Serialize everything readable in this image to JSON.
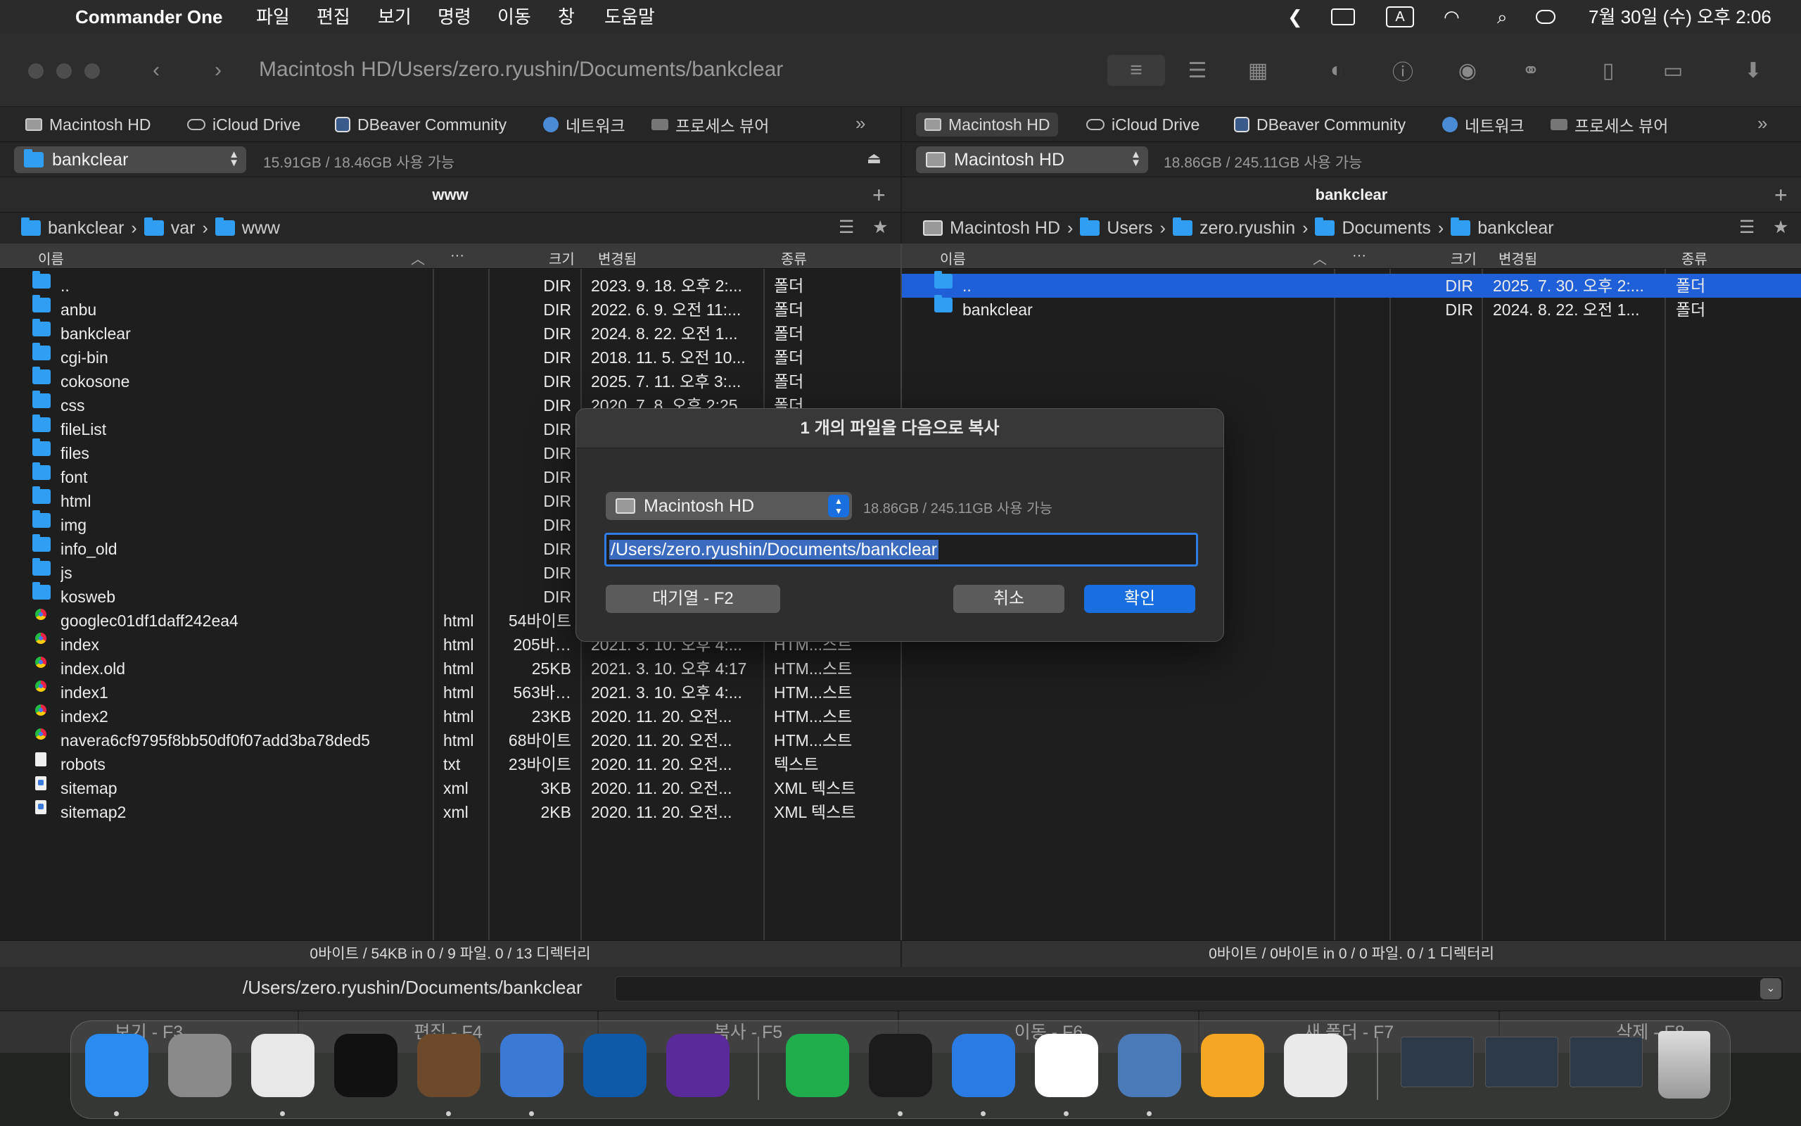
{
  "menubar": {
    "app_name": "Commander One",
    "menus": [
      "파일",
      "편집",
      "보기",
      "명령",
      "이동",
      "창",
      "도움말"
    ],
    "datetime": "7월 30일 (수) 오후 2:06",
    "input_indicator": "A"
  },
  "window": {
    "title_path": "Macintosh HD/Users/zero.ryushin/Documents/bankclear"
  },
  "left": {
    "drives": [
      "Macintosh HD",
      "iCloud Drive",
      "DBeaver Community",
      "네트워크",
      "프로세스 뷰어"
    ],
    "volume": "bankclear",
    "free_space": "15.91GB / 18.46GB 사용 가능",
    "tab_title": "www",
    "breadcrumb": [
      "bankclear",
      "var",
      "www"
    ],
    "columns": {
      "name": "이름",
      "ext": "···",
      "size": "크기",
      "modified": "변경됨",
      "kind": "종류"
    },
    "rows": [
      {
        "name": "..",
        "ext": "",
        "size": "DIR",
        "date": "2023. 9. 18. 오후 2:...",
        "kind": "폴더",
        "icon": "folder"
      },
      {
        "name": "anbu",
        "ext": "",
        "size": "DIR",
        "date": "2022. 6. 9. 오전 11:...",
        "kind": "폴더",
        "icon": "folder"
      },
      {
        "name": "bankclear",
        "ext": "",
        "size": "DIR",
        "date": "2024. 8. 22. 오전 1...",
        "kind": "폴더",
        "icon": "folder"
      },
      {
        "name": "cgi-bin",
        "ext": "",
        "size": "DIR",
        "date": "2018. 11. 5. 오전 10...",
        "kind": "폴더",
        "icon": "folder"
      },
      {
        "name": "cokosone",
        "ext": "",
        "size": "DIR",
        "date": "2025. 7. 11. 오후 3:...",
        "kind": "폴더",
        "icon": "folder"
      },
      {
        "name": "css",
        "ext": "",
        "size": "DIR",
        "date": "2020. 7. 8. 오후 2:25",
        "kind": "폴더",
        "icon": "folder"
      },
      {
        "name": "fileList",
        "ext": "",
        "size": "DIR",
        "date": "",
        "kind": "",
        "icon": "folder"
      },
      {
        "name": "files",
        "ext": "",
        "size": "DIR",
        "date": "",
        "kind": "",
        "icon": "folder"
      },
      {
        "name": "font",
        "ext": "",
        "size": "DIR",
        "date": "",
        "kind": "",
        "icon": "folder"
      },
      {
        "name": "html",
        "ext": "",
        "size": "DIR",
        "date": "",
        "kind": "",
        "icon": "folder"
      },
      {
        "name": "img",
        "ext": "",
        "size": "DIR",
        "date": "",
        "kind": "",
        "icon": "folder"
      },
      {
        "name": "info_old",
        "ext": "",
        "size": "DIR",
        "date": "",
        "kind": "",
        "icon": "folder"
      },
      {
        "name": "js",
        "ext": "",
        "size": "DIR",
        "date": "",
        "kind": "",
        "icon": "folder"
      },
      {
        "name": "kosweb",
        "ext": "",
        "size": "DIR",
        "date": "",
        "kind": "",
        "icon": "folder"
      },
      {
        "name": "googlec01df1daff242ea4",
        "ext": "html",
        "size": "54바이트",
        "date": "",
        "kind": "",
        "icon": "chrome"
      },
      {
        "name": "index",
        "ext": "html",
        "size": "205바…",
        "date": "2021. 3. 10. 오후 4:...",
        "kind": "HTM...스트",
        "icon": "chrome"
      },
      {
        "name": "index.old",
        "ext": "html",
        "size": "25KB",
        "date": "2021. 3. 10. 오후 4:17",
        "kind": "HTM...스트",
        "icon": "chrome"
      },
      {
        "name": "index1",
        "ext": "html",
        "size": "563바…",
        "date": "2021. 3. 10. 오후 4:...",
        "kind": "HTM...스트",
        "icon": "chrome"
      },
      {
        "name": "index2",
        "ext": "html",
        "size": "23KB",
        "date": "2020. 11. 20. 오전...",
        "kind": "HTM...스트",
        "icon": "chrome"
      },
      {
        "name": "navera6cf9795f8bb50df0f07add3ba78ded5",
        "ext": "html",
        "size": "68바이트",
        "date": "2020. 11. 20. 오전...",
        "kind": "HTM...스트",
        "icon": "chrome"
      },
      {
        "name": "robots",
        "ext": "txt",
        "size": "23바이트",
        "date": "2020. 11. 20. 오전...",
        "kind": "텍스트",
        "icon": "text"
      },
      {
        "name": "sitemap",
        "ext": "xml",
        "size": "3KB",
        "date": "2020. 11. 20. 오전...",
        "kind": "XML 텍스트",
        "icon": "xml"
      },
      {
        "name": "sitemap2",
        "ext": "xml",
        "size": "2KB",
        "date": "2020. 11. 20. 오전...",
        "kind": "XML 텍스트",
        "icon": "xml"
      }
    ],
    "status": "0바이트 / 54KB in 0 / 9 파일. 0 / 13 디렉터리"
  },
  "right": {
    "drives": [
      "Macintosh HD",
      "iCloud Drive",
      "DBeaver Community",
      "네트워크",
      "프로세스 뷰어"
    ],
    "volume": "Macintosh HD",
    "free_space": "18.86GB / 245.11GB 사용 가능",
    "tab_title": "bankclear",
    "breadcrumb": [
      "Macintosh HD",
      "Users",
      "zero.ryushin",
      "Documents",
      "bankclear"
    ],
    "columns": {
      "name": "이름",
      "ext": "···",
      "size": "크기",
      "modified": "변경됨",
      "kind": "종류"
    },
    "rows": [
      {
        "name": "..",
        "ext": "",
        "size": "DIR",
        "date": "2025. 7. 30. 오후 2:...",
        "kind": "폴더",
        "icon": "folder"
      },
      {
        "name": "bankclear",
        "ext": "",
        "size": "DIR",
        "date": "2024. 8. 22. 오전 1...",
        "kind": "폴더",
        "icon": "folder"
      }
    ],
    "selected_row": 0,
    "status": "0바이트 / 0바이트 in 0 / 0 파일. 0 / 1 디렉터리"
  },
  "command_line": {
    "path": "/Users/zero.ryushin/Documents/bankclear"
  },
  "function_keys": [
    "보기 - F3",
    "편집 - F4",
    "복사 - F5",
    "이동 - F6",
    "새 폴더 - F7",
    "삭제 - F8"
  ],
  "dialog": {
    "title": "1 개의 파일을 다음으로 복사",
    "volume": "Macintosh HD",
    "free_space": "18.86GB / 245.11GB 사용 가능",
    "destination": "/Users/zero.ryushin/Documents/bankclear",
    "queue_label": "대기열 - F2",
    "cancel_label": "취소",
    "ok_label": "확인"
  },
  "dock": {
    "apps": [
      "finder-icon",
      "launchpad-icon",
      "chrome-icon",
      "intellij-icon",
      "dbeaver-icon",
      "commander-one-icon",
      "vscode-icon",
      "obsidian-icon",
      "numbers-icon",
      "terminal-icon",
      "keynote-icon",
      "naver-whale-icon",
      "preview-icon",
      "pages-icon",
      "naver-works-icon"
    ]
  },
  "colors": {
    "accent": "#1a6fe0",
    "selection": "#1f5fd8",
    "folder": "#2f9ef3"
  }
}
